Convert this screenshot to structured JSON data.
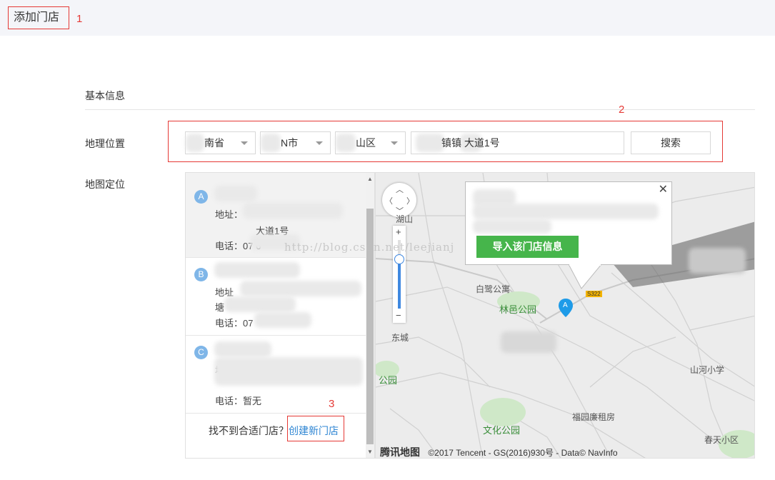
{
  "page": {
    "title": "添加门店",
    "annotations": [
      "1",
      "2",
      "3"
    ]
  },
  "basic_info": {
    "section_label": "基本信息"
  },
  "location": {
    "label": "地理位置",
    "province": "南省",
    "city": "N市",
    "district": "山区",
    "address": "镇镇 大道1号",
    "search_label": "搜索"
  },
  "map_section": {
    "label": "地图定位",
    "results": [
      {
        "marker": "A",
        "addr_label": "地址：",
        "addr_line2": "大道1号",
        "phone": "电话：07 6"
      },
      {
        "marker": "B",
        "addr_label": "地址",
        "addr_line2": "塘",
        "phone": "电话：07"
      },
      {
        "marker": "C",
        "addr_label": "地址",
        "addr_line2": "",
        "phone": "电话：暂无"
      }
    ],
    "not_found_text": "找不到合适门店？",
    "create_link": "创建新门店"
  },
  "map": {
    "popup_import_button": "导入该门店信息",
    "pin_marker": "A",
    "road_badge": "S322",
    "labels": {
      "poi_1": "白鹭公寓",
      "park_1": "林邑公园",
      "poi_2": "山河小学",
      "poi_3": "福园廉租房",
      "park_2": "文化公园",
      "poi_4": "春天小区",
      "poi_5": "湖山",
      "poi_6": "东城",
      "park_3": "公园"
    },
    "brand": "腾讯地图",
    "copyright": "©2017 Tencent - GS(2016)930号 - Data© NavInfo"
  },
  "watermark": "http://blog.csdn.net/leejianj",
  "colors": {
    "annotation_red": "#e53935",
    "link_blue": "#2f86d3",
    "import_green": "#46b54b",
    "pin_blue": "#1e9be8"
  }
}
